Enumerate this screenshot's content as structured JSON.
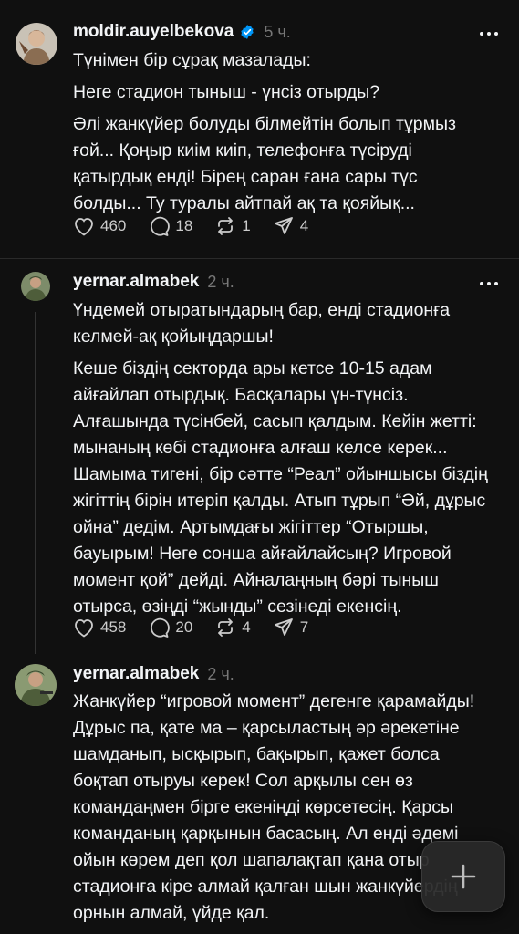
{
  "posts": [
    {
      "username": "moldir.auyelbekova",
      "verified": true,
      "time": "5 ч.",
      "paragraphs": [
        "Түнімен бір сұрақ мазалады:",
        "Неге стадион тыныш - үнсіз отырды?",
        "Әлі жанкүйер болуды білмейтін болып тұрмыз ғой... Қоңыр киім киіп, телефонға түсіруді қатырдық енді! Бірең саран ғана сары түс болды... Ту туралы айтпай ақ та қояйық..."
      ],
      "likes": "460",
      "comments": "18",
      "reposts": "1",
      "shares": "4"
    },
    {
      "username": "yernar.almabek",
      "verified": false,
      "time": "2 ч.",
      "paragraphs": [
        "Үндемей отыратындарың бар, енді стадионға келмей-ақ қойыңдаршы!",
        "Кеше біздің секторда ары кетсе 10-15 адам айғайлап отырдық. Басқалары үн-түнсіз. Алғашында түсінбей, сасып қалдым. Кейін жетті: мынаның көбі стадионға алғаш келсе керек... Шамыма тигені, бір сәтте “Реал” ойыншысы біздің жігіттің бірін итеріп қалды. Атып тұрып “Әй, дұрыс ойна” дедім. Артымдағы жігіттер “Отыршы, бауырым! Неге сонша айғайлайсың? Игровой момент қой” дейді. Айналаңның бәрі тыныш отырса, өзіңді “жынды” сезінеді екенсің."
      ],
      "likes": "458",
      "comments": "20",
      "reposts": "4",
      "shares": "7"
    },
    {
      "username": "yernar.almabek",
      "verified": false,
      "time": "2 ч.",
      "paragraphs": [
        "Жанкүйер “игровой момент” дегенге қарамайды! Дұрыс па, қате ма – қарсыластың әр әрекетіне шамданып, ысқырып, бақырып, қажет болса боқтап отыруы керек! Сол арқылы сен өз командаңмен бірге екеніңді көрсетесің. Қарсы команданың қарқынын басасың. Ал енді әдемі ойын көрем деп қол шапалақтап қана отыр стадионға кіре алмай қалған шын жанкүйердің орнын алмай, үйде қал."
      ]
    }
  ],
  "more_icon": "more-horizontal-icon",
  "new_post_icon": "plus-icon",
  "colors": {
    "background": "#101010",
    "text": "#f3f5f7",
    "secondary": "#777777",
    "verified": "#0095f6"
  }
}
